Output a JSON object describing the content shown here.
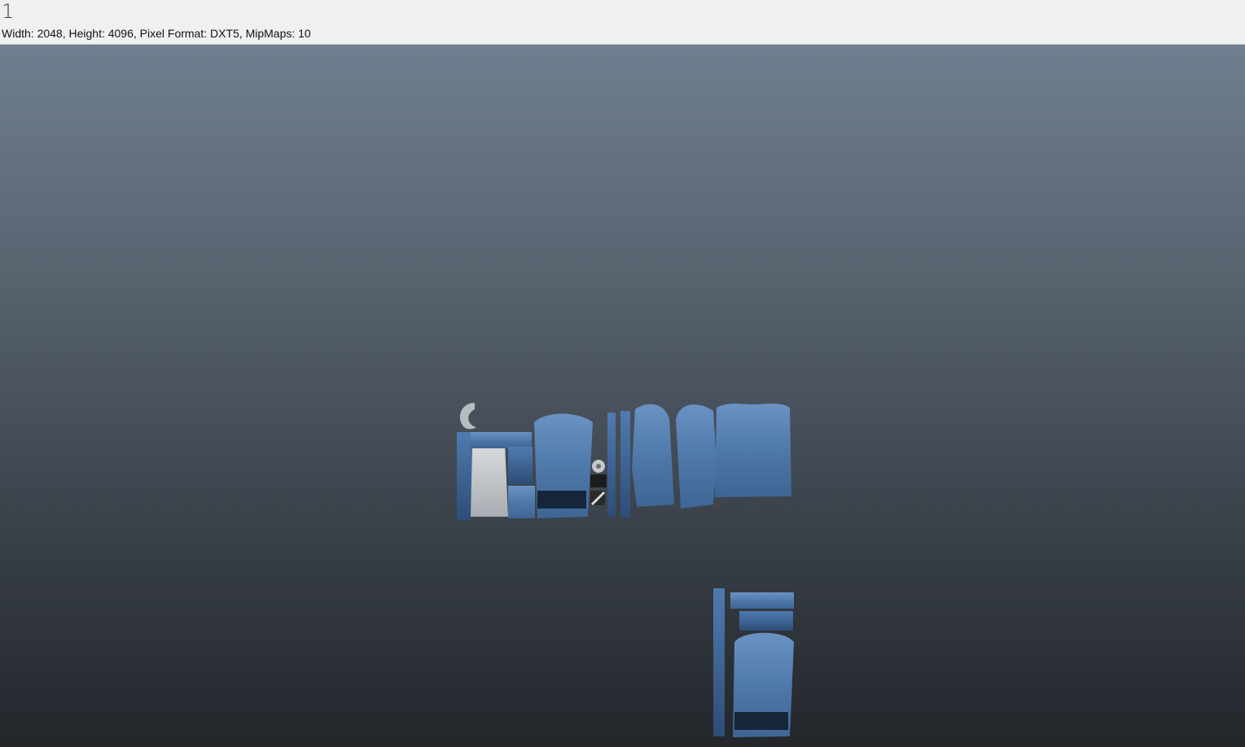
{
  "header": {
    "texture_name": "1",
    "info": "Width: 2048, Height: 4096, Pixel Format: DXT5, MipMaps: 10"
  },
  "viewport": {
    "content": "denim-vest-texture-atlas",
    "colors": {
      "denim_light": "#5b86b8",
      "denim_dark": "#2b4a72",
      "background_top": "#6f7f8f",
      "background_bottom": "#23262b"
    }
  }
}
